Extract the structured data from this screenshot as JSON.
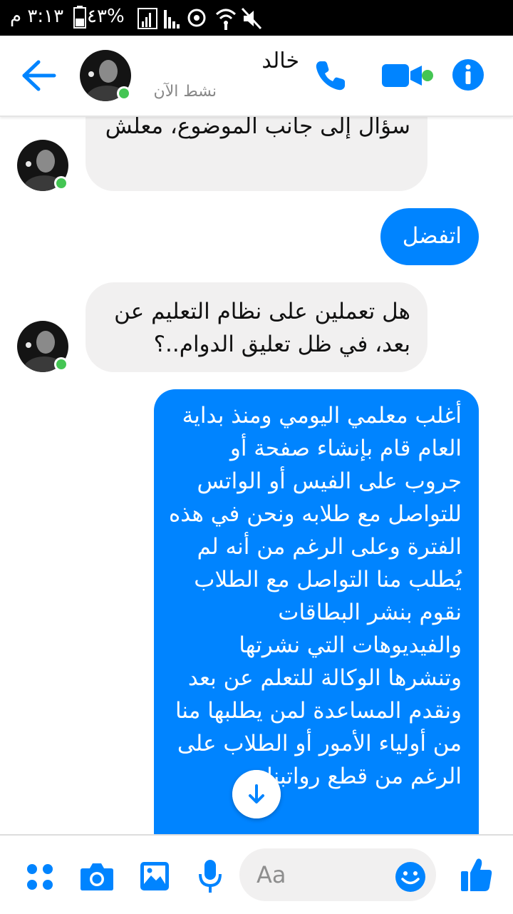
{
  "status_bar": {
    "time": "٣:١٣ م",
    "battery": "%٤٣"
  },
  "header": {
    "contact_name": "خالد",
    "contact_status": "نشط الآن"
  },
  "messages": [
    {
      "direction": "incoming",
      "text": "سؤال إلى جانب الموضوع، معلش"
    },
    {
      "direction": "outgoing",
      "text": "اتفضل"
    },
    {
      "direction": "incoming",
      "text": "هل تعملين على نظام التعليم عن بعد، في ظل تعليق الدوام..؟"
    },
    {
      "direction": "outgoing",
      "text": "أغلب معلمي اليومي ومنذ بداية العام قام بإنشاء صفحة أو جروب على الفيس أو الواتس للتواصل مع طلابه ونحن في هذه الفترة وعلى الرغم من أنه لم يُطلب منا التواصل مع الطلاب نقوم بنشر البطاقات والفيديوهات التي نشرتها وتنشرها الوكالة للتعلم عن بعد ونقدم المساعدة لمن يطلبها منا من أولياء الأمور أو الطلاب على الرغم من قطع رواتبنا"
    }
  ],
  "composer": {
    "placeholder": "Aa"
  },
  "colors": {
    "accent": "#0084ff",
    "online": "#44c553",
    "incoming_bubble": "#f1f0f0"
  }
}
